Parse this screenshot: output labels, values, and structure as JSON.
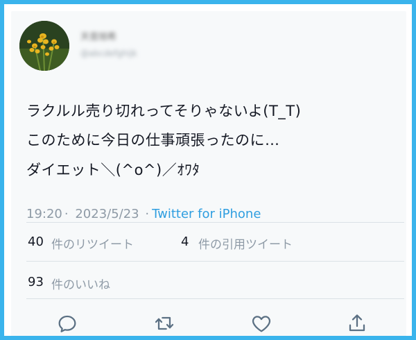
{
  "user": {
    "display_name": "天音旭希",
    "handle": "@abcdefghijk"
  },
  "tweet": {
    "lines": [
      "ラクルル売り切れってそりゃないよ(T_T)",
      "このために今日の仕事頑張ったのに…",
      "ダイエット＼(^o^)／ｵﾜﾀ"
    ],
    "time": "19:20",
    "date": "2023/5/23",
    "source": "Twitter for iPhone"
  },
  "stats": {
    "retweets_count": "40",
    "retweets_label": "件のリツイート",
    "quotes_count": "4",
    "quotes_label": "件の引用ツイート",
    "likes_count": "93",
    "likes_label": "件のいいね"
  },
  "actions": {
    "reply_icon": "reply-icon",
    "retweet_icon": "retweet-icon",
    "like_icon": "heart-icon",
    "share_icon": "share-icon"
  },
  "colors": {
    "frame_border": "#3ab4ec",
    "link": "#2f9ee0",
    "secondary_text": "#8e9aa6",
    "primary_text": "#141823",
    "icon": "#5b7083"
  }
}
